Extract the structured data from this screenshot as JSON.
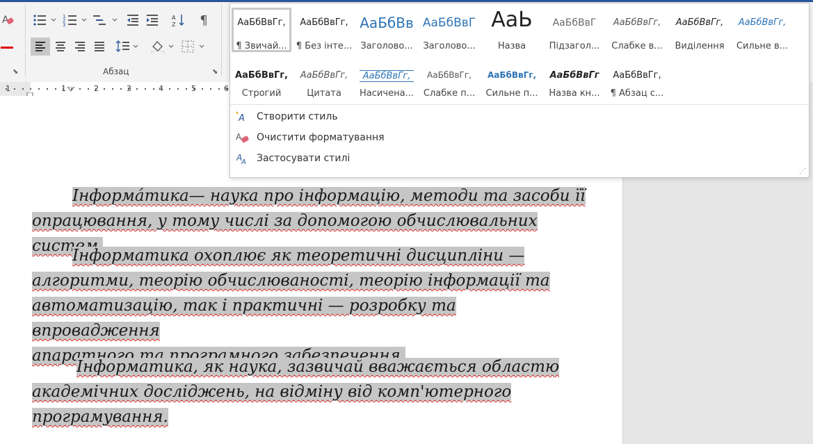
{
  "ribbon": {
    "group_label": "Абзац"
  },
  "styles": {
    "row1": [
      {
        "sample": "АаБбВвГг,",
        "label": "¶ Звичай...",
        "selected": true
      },
      {
        "sample": "АаБбВвГг,",
        "label": "¶ Без інте..."
      },
      {
        "sample": "АаБбВв",
        "label": "Заголово..."
      },
      {
        "sample": "АаБбВвГ",
        "label": "Заголово..."
      },
      {
        "sample": "АаЬ",
        "label": "Назва"
      },
      {
        "sample": "АаБбВвГ",
        "label": "Підзагол..."
      },
      {
        "sample": "АаБбВвГг,",
        "label": "Слабке в..."
      },
      {
        "sample": "АаБбВвГг,",
        "label": "Виділення"
      },
      {
        "sample": "АаБбВвГг,",
        "label": "Сильне в..."
      }
    ],
    "row2": [
      {
        "sample": "АаБбВвГг,",
        "label": "Строгий"
      },
      {
        "sample": "АаБбВвГг,",
        "label": "Цитата"
      },
      {
        "sample": "АаБбВвГг,",
        "label": "Насичена..."
      },
      {
        "sample": "АаБбВвГг,",
        "label": "Слабке п..."
      },
      {
        "sample": "АаБбВвГг,",
        "label": "Сильне п..."
      },
      {
        "sample": "АаБбВвГг",
        "label": "Назва кн..."
      },
      {
        "sample": "АаБбВвГг,",
        "label": "¶ Абзац с..."
      }
    ],
    "menu": [
      {
        "label": "Створити стиль",
        "icon": "create-style-icon"
      },
      {
        "label": "Очистити форматування",
        "icon": "clear-formatting-icon"
      },
      {
        "label": "Застосувати стилі",
        "icon": "apply-styles-icon"
      }
    ]
  },
  "ruler": {
    "numbers": [
      "1",
      "1",
      "2",
      "3",
      "4",
      "5",
      "6"
    ]
  },
  "document": {
    "p1": {
      "l1a": "Інформа́тика",
      "l1b": "— наука про інформацію, методи та засоби її",
      "l2": "опрацювання, у тому числі за допомогою обчислювальних систем."
    },
    "p2": {
      "l1": "Інформатика охоплює як теоретичні дисципліни —",
      "l2": "алгоритми, теорію обчислюваності, теорію інформації та",
      "l3": "автоматизацію, так і практичні — розробку та впровадження",
      "l4": "апаратного та програмного забезпечення."
    },
    "p3": {
      "l1": "Інформатика, як наука, зазвичай вважається областю",
      "l2": "академічних досліджень, на відміну від комп'ютерного",
      "l3": "програмування."
    }
  }
}
